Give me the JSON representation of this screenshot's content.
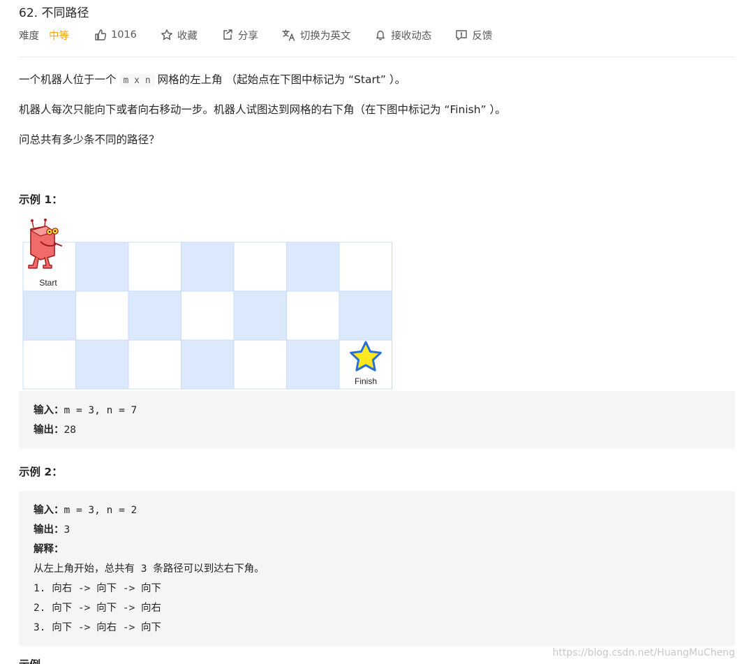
{
  "problem": {
    "title": "62. 不同路径"
  },
  "toolbar": {
    "difficulty_label": "难度",
    "difficulty_value": "中等",
    "likes": "1016",
    "favorite": "收藏",
    "share": "分享",
    "translate": "切换为英文",
    "notify": "接收动态",
    "feedback": "反馈"
  },
  "description": {
    "p1_before": "一个机器人位于一个",
    "p1_code": "m x n",
    "p1_after": "网格的左上角 （起始点在下图中标记为 “Start” ）。",
    "p2": "机器人每次只能向下或者向右移动一步。机器人试图达到网格的右下角（在下图中标记为 “Finish” ）。",
    "p3": "问总共有多少条不同的路径？"
  },
  "example1": {
    "heading": "示例 1：",
    "grid": {
      "rows": 3,
      "cols": 7,
      "start_label": "Start",
      "finish_label": "Finish",
      "colors": {
        "light": "#dce9fc",
        "white": "#ffffff",
        "border": "#c9dcf7"
      }
    },
    "input_label": "输入：",
    "input_value": "m = 3, n = 7",
    "output_label": "输出：",
    "output_value": "28"
  },
  "example2": {
    "heading": "示例 2：",
    "input_label": "输入：",
    "input_value": "m = 3, n = 2",
    "output_label": "输出：",
    "output_value": "3",
    "explain_label": "解释：",
    "explain_lines": [
      "从左上角开始，总共有 3 条路径可以到达右下角。",
      "1. 向右 -> 向下 -> 向下",
      "2. 向下 -> 向下 -> 向右",
      "3. 向下 -> 向右 -> 向下"
    ]
  },
  "cutoff_heading": "示例",
  "watermark": "https://blog.csdn.net/HuangMuCheng"
}
